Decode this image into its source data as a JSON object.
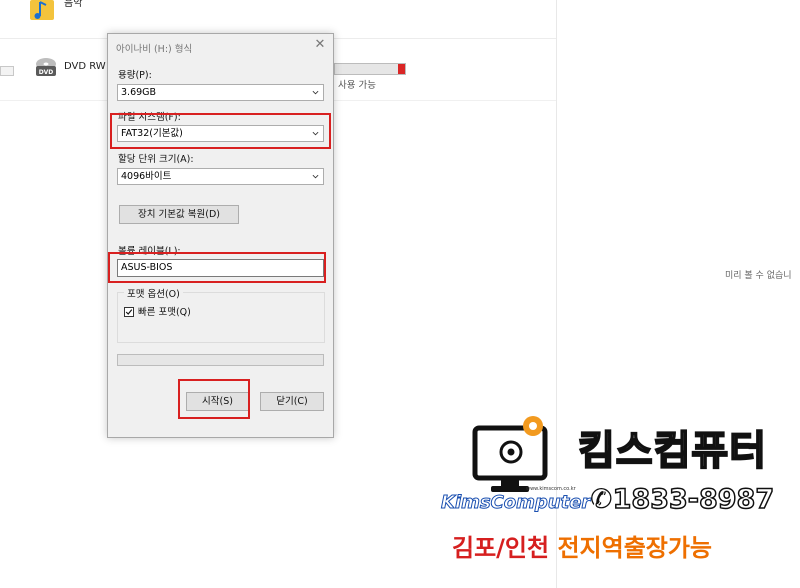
{
  "explorer": {
    "music_label": "음악",
    "dvd_label": "DVD RW 드",
    "drive_free_text": "사용 가능",
    "drive_used_fraction": 0.1,
    "preview_text": "미리 볼 수 없습니",
    "dvd_icon_text": "DVD"
  },
  "dialog": {
    "title": "아이나비 (H:) 형식",
    "capacity_label": "용량(P):",
    "capacity_value": "3.69GB",
    "filesystem_label": "파일 시스템(F):",
    "filesystem_value": "FAT32(기본값)",
    "alloc_label": "할당 단위 크기(A):",
    "alloc_value": "4096바이트",
    "restore_button": "장치 기본값 복원(D)",
    "volume_label": "볼륨 레이블(L):",
    "volume_value": "ASUS-BIOS",
    "format_options_label": "포맷 옵션(O)",
    "quick_format_label": "빠른 포맷(Q)",
    "quick_format_checked": true,
    "start_button": "시작(S)",
    "close_button": "닫기(C)",
    "highlight_color": "#d82020"
  },
  "promo": {
    "company_name": "킴스컴퓨터",
    "brand": "KimsComputer",
    "site": "www.kimscom.co.kr",
    "phone": "1833-8987",
    "area_red": "김포/인천",
    "area_orange": "전지역출장가능",
    "accent_red": "#d61f1f",
    "accent_orange": "#ee6f00"
  }
}
